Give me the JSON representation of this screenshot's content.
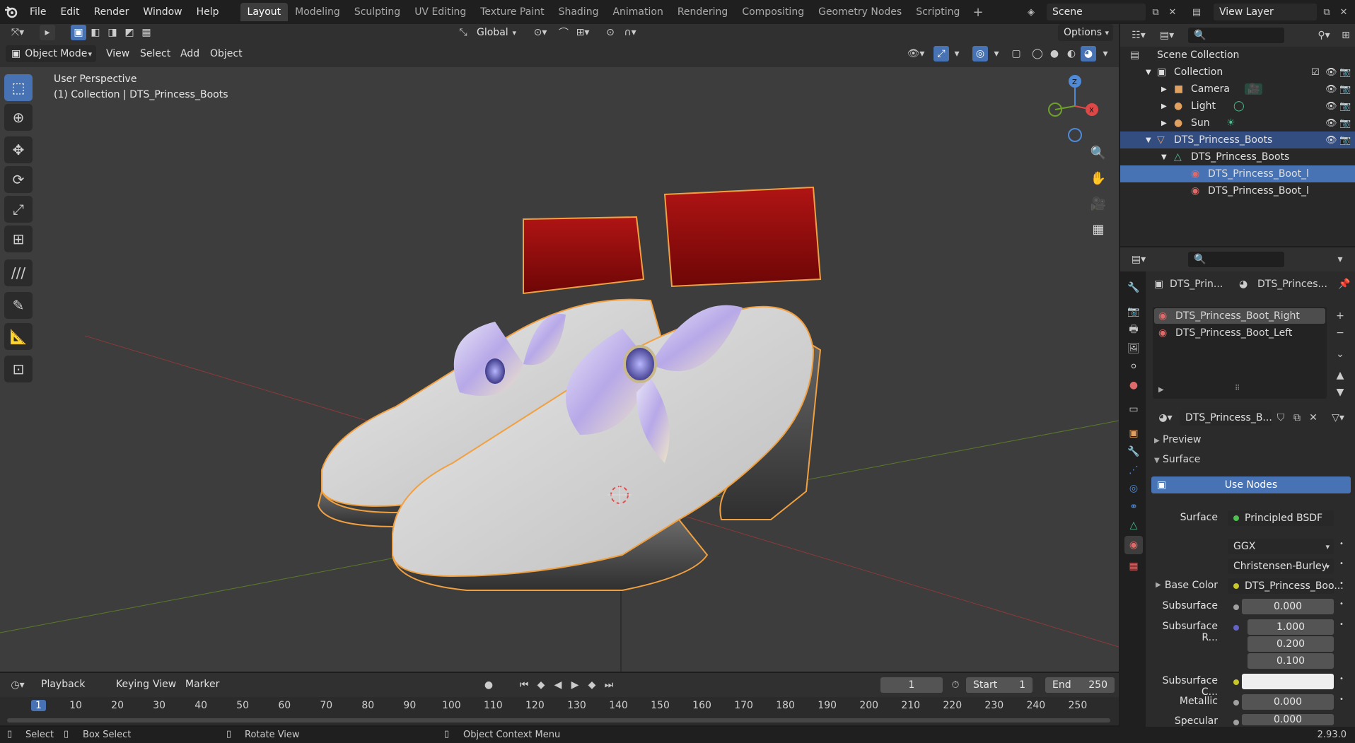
{
  "app": {
    "menus": [
      "File",
      "Edit",
      "Render",
      "Window",
      "Help"
    ],
    "workspaces": [
      "Layout",
      "Modeling",
      "Sculpting",
      "UV Editing",
      "Texture Paint",
      "Shading",
      "Animation",
      "Rendering",
      "Compositing",
      "Geometry Nodes",
      "Scripting"
    ],
    "active_workspace": "Layout",
    "scene": "Scene",
    "view_layer": "View Layer",
    "version": "2.93.0"
  },
  "viewport_header": {
    "transform_orientation": "Global",
    "options": "Options",
    "mode": "Object Mode",
    "menus": [
      "View",
      "Select",
      "Add",
      "Object"
    ]
  },
  "viewport": {
    "perspective": "User Perspective",
    "collection_info": "(1) Collection | DTS_Princess_Boots",
    "gizmo_axes": {
      "z": "Z",
      "x": "X",
      "y": "Y"
    }
  },
  "outliner": {
    "items": [
      {
        "label": "Scene Collection",
        "depth": 0,
        "icon": "scene-collection-icon"
      },
      {
        "label": "Collection",
        "depth": 1,
        "icon": "collection-icon"
      },
      {
        "label": "Camera",
        "depth": 2,
        "icon": "camera-icon"
      },
      {
        "label": "Light",
        "depth": 2,
        "icon": "light-icon"
      },
      {
        "label": "Sun",
        "depth": 2,
        "icon": "sun-icon"
      },
      {
        "label": "DTS_Princess_Boots",
        "depth": 1,
        "icon": "mesh-object-icon"
      },
      {
        "label": "DTS_Princess_Boots",
        "depth": 2,
        "icon": "mesh-data-icon"
      },
      {
        "label": "DTS_Princess_Boot_l",
        "depth": 3,
        "icon": "material-icon"
      },
      {
        "label": "DTS_Princess_Boot_l",
        "depth": 3,
        "icon": "material-icon"
      }
    ]
  },
  "properties": {
    "breadcrumb_object": "DTS_Prin...",
    "breadcrumb_material": "DTS_Princes...",
    "material_slots": [
      "DTS_Princess_Boot_Right",
      "DTS_Princess_Boot_Left"
    ],
    "material_name": "DTS_Princess_B...",
    "panel_preview": "Preview",
    "panel_surface": "Surface",
    "use_nodes": "Use Nodes",
    "surface_label": "Surface",
    "surface_value": "Principled BSDF",
    "distribution": "GGX",
    "subsurface_method": "Christensen-Burley",
    "base_color_label": "Base Color",
    "base_color_value": "DTS_Princess_Boo...",
    "subsurface_label": "Subsurface",
    "subsurface_value": "0.000",
    "subsurface_radius_label": "Subsurface R...",
    "subsurface_radius": [
      "1.000",
      "0.200",
      "0.100"
    ],
    "subsurface_color_label": "Subsurface C...",
    "metallic_label": "Metallic",
    "metallic_value": "0.000",
    "specular_label": "Specular",
    "specular_value": "0.000"
  },
  "timeline": {
    "menus": [
      "Playback",
      "Keying",
      "View",
      "Marker"
    ],
    "current_frame": "1",
    "start_label": "Start",
    "start_value": "1",
    "end_label": "End",
    "end_value": "250",
    "ticks": [
      "1",
      "10",
      "20",
      "30",
      "40",
      "50",
      "60",
      "70",
      "80",
      "90",
      "100",
      "110",
      "120",
      "130",
      "140",
      "150",
      "160",
      "170",
      "180",
      "190",
      "200",
      "210",
      "220",
      "230",
      "240",
      "250"
    ]
  },
  "statusbar": {
    "select": "Select",
    "box_select": "Box Select",
    "rotate_view": "Rotate View",
    "context_menu": "Object Context Menu"
  }
}
